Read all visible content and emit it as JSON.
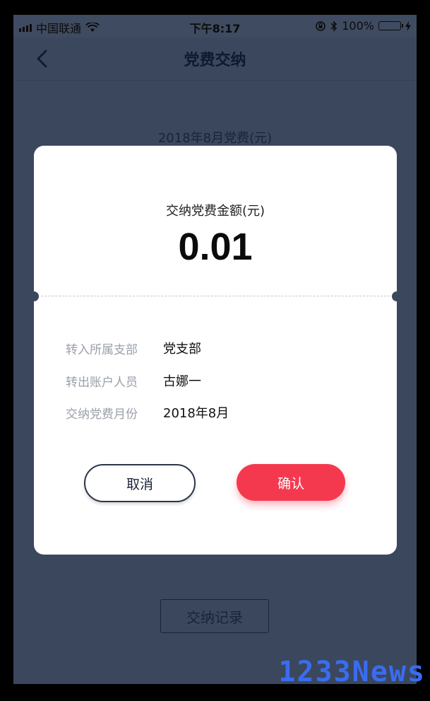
{
  "status_bar": {
    "carrier": "中国联通",
    "time": "下午8:17",
    "battery": "100%",
    "battery_color": "#3ec441"
  },
  "nav": {
    "title": "党费交纳",
    "back_icon": "chevron-left-icon"
  },
  "background": {
    "month_label": "2018年8月党费(元)",
    "history_button": "交纳记录"
  },
  "modal": {
    "amount_label": "交纳党费金额(元)",
    "amount_value": "0.01",
    "rows": [
      {
        "label": "转入所属支部",
        "value": "党支部"
      },
      {
        "label": "转出账户人员",
        "value": "古娜一"
      },
      {
        "label": "交纳党费月份",
        "value": "2018年8月"
      }
    ],
    "cancel_label": "取消",
    "confirm_label": "确认",
    "confirm_color": "#f4394f"
  },
  "watermark": "1233News"
}
